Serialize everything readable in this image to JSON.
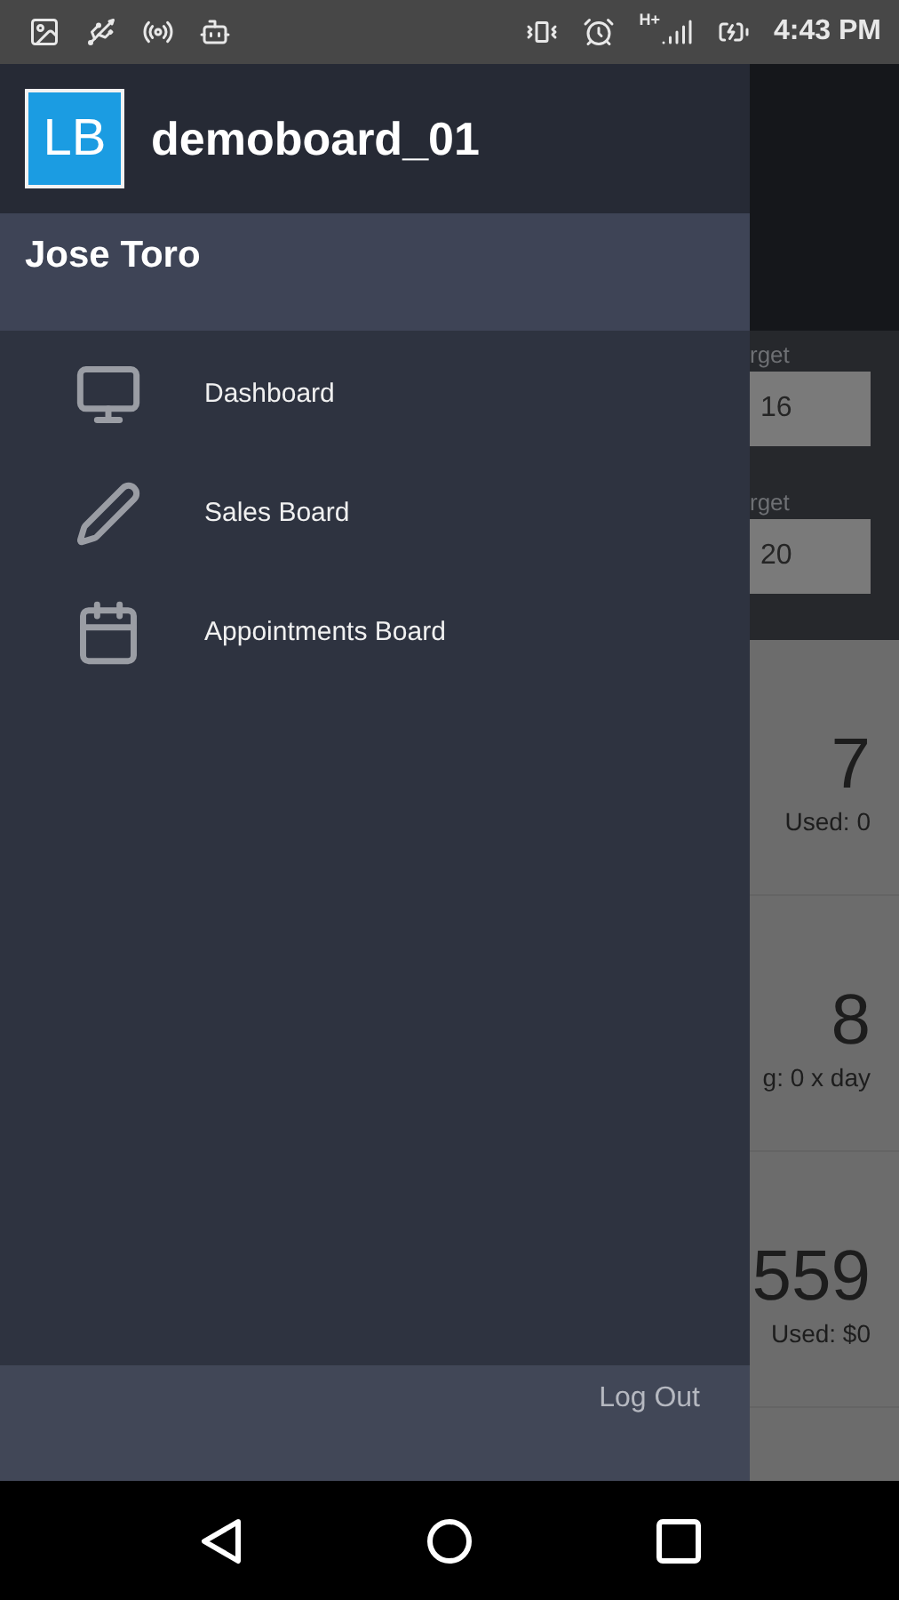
{
  "status_bar": {
    "network": "H+",
    "time": "4:43 PM"
  },
  "drawer": {
    "logo": "LB",
    "title": "demoboard_01",
    "user": "Jose Toro",
    "items": [
      {
        "label": "Dashboard"
      },
      {
        "label": "Sales Board"
      },
      {
        "label": "Appointments Board"
      }
    ],
    "logout": "Log Out"
  },
  "background": {
    "fields": [
      {
        "label": "rget",
        "value": "16"
      },
      {
        "label": "rget",
        "value": "20"
      }
    ],
    "cards": [
      {
        "value": "7",
        "caption": "Used: 0"
      },
      {
        "value": "8",
        "caption": "g: 0 x day"
      },
      {
        "value": "559",
        "caption": "Used: $0"
      }
    ]
  }
}
